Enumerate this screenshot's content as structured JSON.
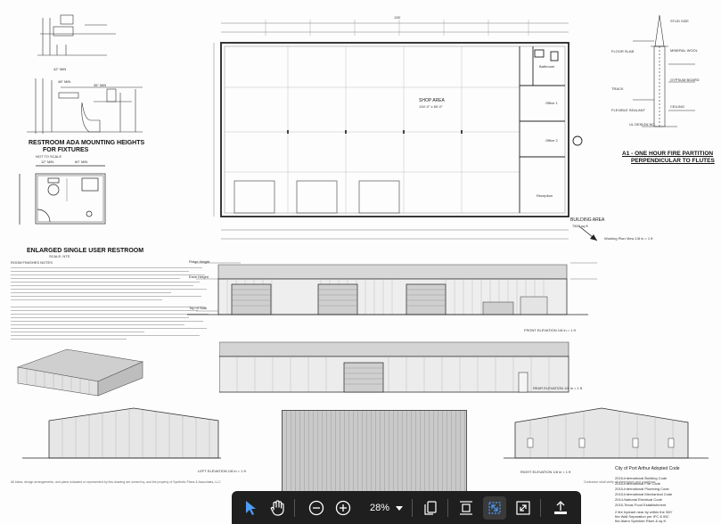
{
  "restroom": {
    "mounting_title": "RESTROOM ADA MOUNTING HEIGHTS",
    "mounting_subtitle": "FOR FIXTURES",
    "mounting_note": "NOT TO SCALE",
    "enlarged_title": "ENLARGED SINGLE USER RESTROOM",
    "enlarged_scale": "SCALE: NTS",
    "notes_header": "ROOM FINISHES NOTES",
    "dims": [
      "42\" MIN",
      "36\" MIN",
      "48\" MIN",
      "12\" MIN",
      "60\" MIN",
      "34\" MAX",
      "33\" MAX",
      "19\" MIN"
    ]
  },
  "plan": {
    "shop_area_label": "SHOP AREA",
    "shop_area_size": "134'-0\" x 60'-0\"",
    "bathroom_label": "Bathroom",
    "office1_label": "Office 1",
    "office2_label": "Office 2",
    "reception_label": "Reception",
    "building_area_label": "BUILDING AREA",
    "building_area_value": "7500 sq ft",
    "scale_text": "Working Plan View  1/8 in = 1 ft",
    "total_dim": "135'"
  },
  "partition": {
    "title_line1": "A1 - ONE HOUR FIRE PARTITION",
    "title_line2": "PERPENDICULAR TO FLUTES",
    "callouts": [
      "STUD SIZE",
      "MINERAL WOOL",
      "FLOOR SLAB",
      "GYPSUM BOARD",
      "TRACK",
      "FLEXIBLE SEALANT",
      "CEILING",
      "UL DESIGN NO."
    ]
  },
  "elevations": {
    "front": "FRONT ELEVATION  1/8 in = 1 ft",
    "rear": "REAR ELEVATION  1/8 in = 1 ft",
    "left": "LEFT ELEVATION  1/8 in = 1 ft",
    "right": "RIGHT ELEVATION  1/8 in = 1 ft",
    "height_tags": [
      "Ridge Height",
      "Eave Height",
      "Top of Slab"
    ]
  },
  "codes": {
    "title": "City of Port Arthur Adopted Code",
    "items": [
      "2015-International Building Code",
      "2015-International Fire Code",
      "2015-International Plumbing Code",
      "2015-International Mechanical Code",
      "2014-National Electrical Code",
      "2015-Texas Food Establishment"
    ],
    "notes": [
      "2 fire hydrant near by within the 300'",
      "fire Wall Separation per IFC & IBC",
      "fire Alarm Sprinkler Riser & sq ft"
    ]
  },
  "footer": {
    "left": "All ideas, design arrangements, and plans indicated or represented by this drawing are owned by, and the property of Synthetic Plans & Associates, LLC",
    "right": "Contractor shall verify all dimensions and conditions"
  },
  "toolbar": {
    "zoom": "28%",
    "icons": [
      "cursor-icon",
      "hand-icon",
      "zoom-out-icon",
      "zoom-in-icon",
      "chevron-down-icon",
      "pages-icon",
      "fit-page-icon",
      "fit-width-icon",
      "fullscreen-icon",
      "export-icon"
    ],
    "colors": {
      "background": "#1f1f1f",
      "icon": "#ffffff",
      "active_icon": "#4a9eff"
    }
  }
}
